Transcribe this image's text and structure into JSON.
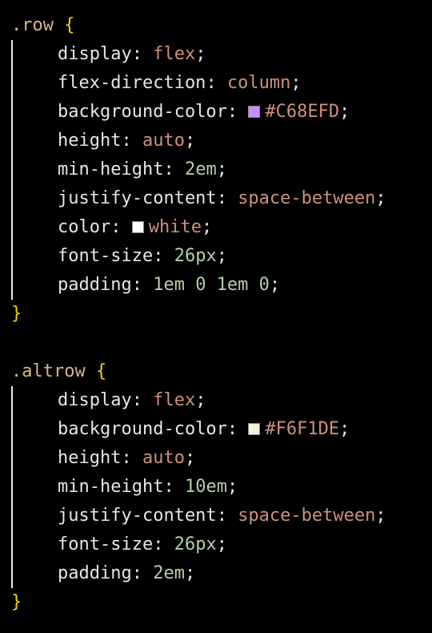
{
  "colors": {
    "row_swatch": "#C68EFD",
    "color_swatch": "#FFFFFF",
    "altrow_swatch": "#F6F1DE"
  },
  "rules": [
    {
      "selector": ".row",
      "open": "{",
      "close": "}",
      "declarations": [
        {
          "prop": "display",
          "value": "flex"
        },
        {
          "prop": "flex-direction",
          "value": "column"
        },
        {
          "prop": "background-color",
          "value": "#C68EFD"
        },
        {
          "prop": "height",
          "value": "auto"
        },
        {
          "prop": "min-height",
          "value": "2em"
        },
        {
          "prop": "justify-content",
          "value": "space-between"
        },
        {
          "prop": "color",
          "value": "white"
        },
        {
          "prop": "font-size",
          "value": "26px"
        },
        {
          "prop": "padding",
          "value": "1em 0 1em 0"
        }
      ]
    },
    {
      "selector": ".altrow",
      "open": "{",
      "close": "}",
      "declarations": [
        {
          "prop": "display",
          "value": "flex"
        },
        {
          "prop": "background-color",
          "value": "#F6F1DE"
        },
        {
          "prop": "height",
          "value": "auto"
        },
        {
          "prop": "min-height",
          "value": "10em"
        },
        {
          "prop": "justify-content",
          "value": "space-between"
        },
        {
          "prop": "font-size",
          "value": "26px"
        },
        {
          "prop": "padding",
          "value": "2em"
        }
      ]
    }
  ]
}
